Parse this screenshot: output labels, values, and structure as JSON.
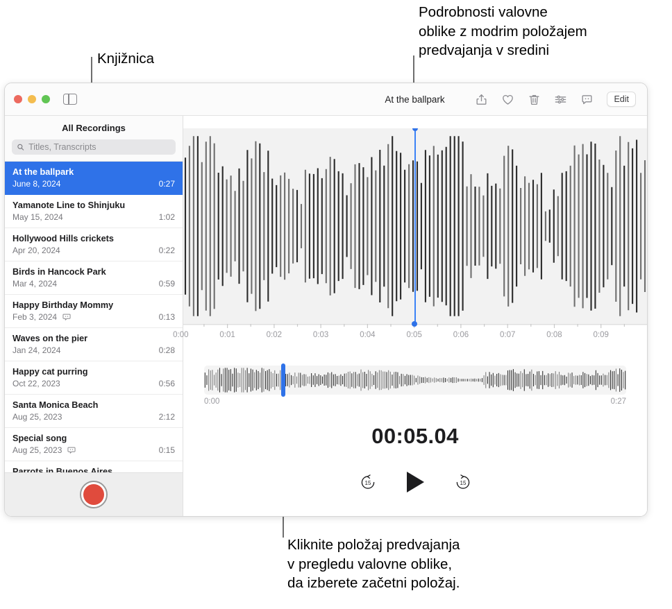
{
  "callouts": {
    "top": "Podrobnosti valovne\noblike z modrim položajem\npredvajanja v sredini",
    "left": "Knjižnica",
    "bottom": "Kliknite položaj predvajanja\nv pregledu valovne oblike,\nda izberete začetni položaj."
  },
  "window": {
    "title": "At the ballpark",
    "traffic_lights": [
      "close",
      "minimize",
      "zoom"
    ],
    "sidebar_toggle_icon": "sidebar-toggle-icon",
    "toolbar": {
      "share_icon": "share-icon",
      "favorite_icon": "heart-icon",
      "delete_icon": "trash-icon",
      "enhance_icon": "sliders-icon",
      "transcript_icon": "transcript-bubble-icon",
      "edit_label": "Edit"
    }
  },
  "sidebar": {
    "title": "All Recordings",
    "search": {
      "icon": "search-icon",
      "placeholder": "Titles, Transcripts",
      "value": ""
    },
    "record_button": "record-button",
    "recordings": [
      {
        "title": "At the ballpark",
        "date": "June 8, 2024",
        "duration": "0:27",
        "badge": false,
        "selected": true
      },
      {
        "title": "Yamanote Line to Shinjuku",
        "date": "May 15, 2024",
        "duration": "1:02",
        "badge": false,
        "selected": false
      },
      {
        "title": "Hollywood Hills crickets",
        "date": "Apr 20, 2024",
        "duration": "0:22",
        "badge": false,
        "selected": false
      },
      {
        "title": "Birds in Hancock Park",
        "date": "Mar 4, 2024",
        "duration": "0:59",
        "badge": false,
        "selected": false
      },
      {
        "title": "Happy Birthday Mommy",
        "date": "Feb 3, 2024",
        "duration": "0:13",
        "badge": true,
        "selected": false
      },
      {
        "title": "Waves on the pier",
        "date": "Jan 24, 2024",
        "duration": "0:28",
        "badge": false,
        "selected": false
      },
      {
        "title": "Happy cat purring",
        "date": "Oct 22, 2023",
        "duration": "0:56",
        "badge": false,
        "selected": false
      },
      {
        "title": "Santa Monica Beach",
        "date": "Aug 25, 2023",
        "duration": "2:12",
        "badge": false,
        "selected": false
      },
      {
        "title": "Special song",
        "date": "Aug 25, 2023",
        "duration": "0:15",
        "badge": true,
        "selected": false
      },
      {
        "title": "Parrots in Buenos Aires",
        "date": "",
        "duration": "",
        "badge": false,
        "selected": false
      }
    ]
  },
  "detail": {
    "ruler_ticks": [
      "0:01",
      "0:02",
      "0:03",
      "0:04",
      "0:05",
      "0:06",
      "0:07",
      "0:08",
      "0:09"
    ],
    "playhead_position_pct": 49.8,
    "overview": {
      "start_label": "0:00",
      "end_label": "0:27",
      "playhead_position_pct": 18.7
    },
    "time_display": "00:05.04",
    "transport": {
      "skip_back_label": "15",
      "skip_back_icon": "skip-back-15-icon",
      "play_icon": "play-icon",
      "skip_forward_label": "15",
      "skip_forward_icon": "skip-forward-15-icon"
    }
  },
  "colors": {
    "accent_blue": "#2f72e8",
    "playhead_blue": "#3b82f6",
    "record_red": "#e04b3d",
    "waveform_bg": "#f2f2f2",
    "bar_dark": "#2b2b2b",
    "bar_gray": "#6f6f6f"
  }
}
